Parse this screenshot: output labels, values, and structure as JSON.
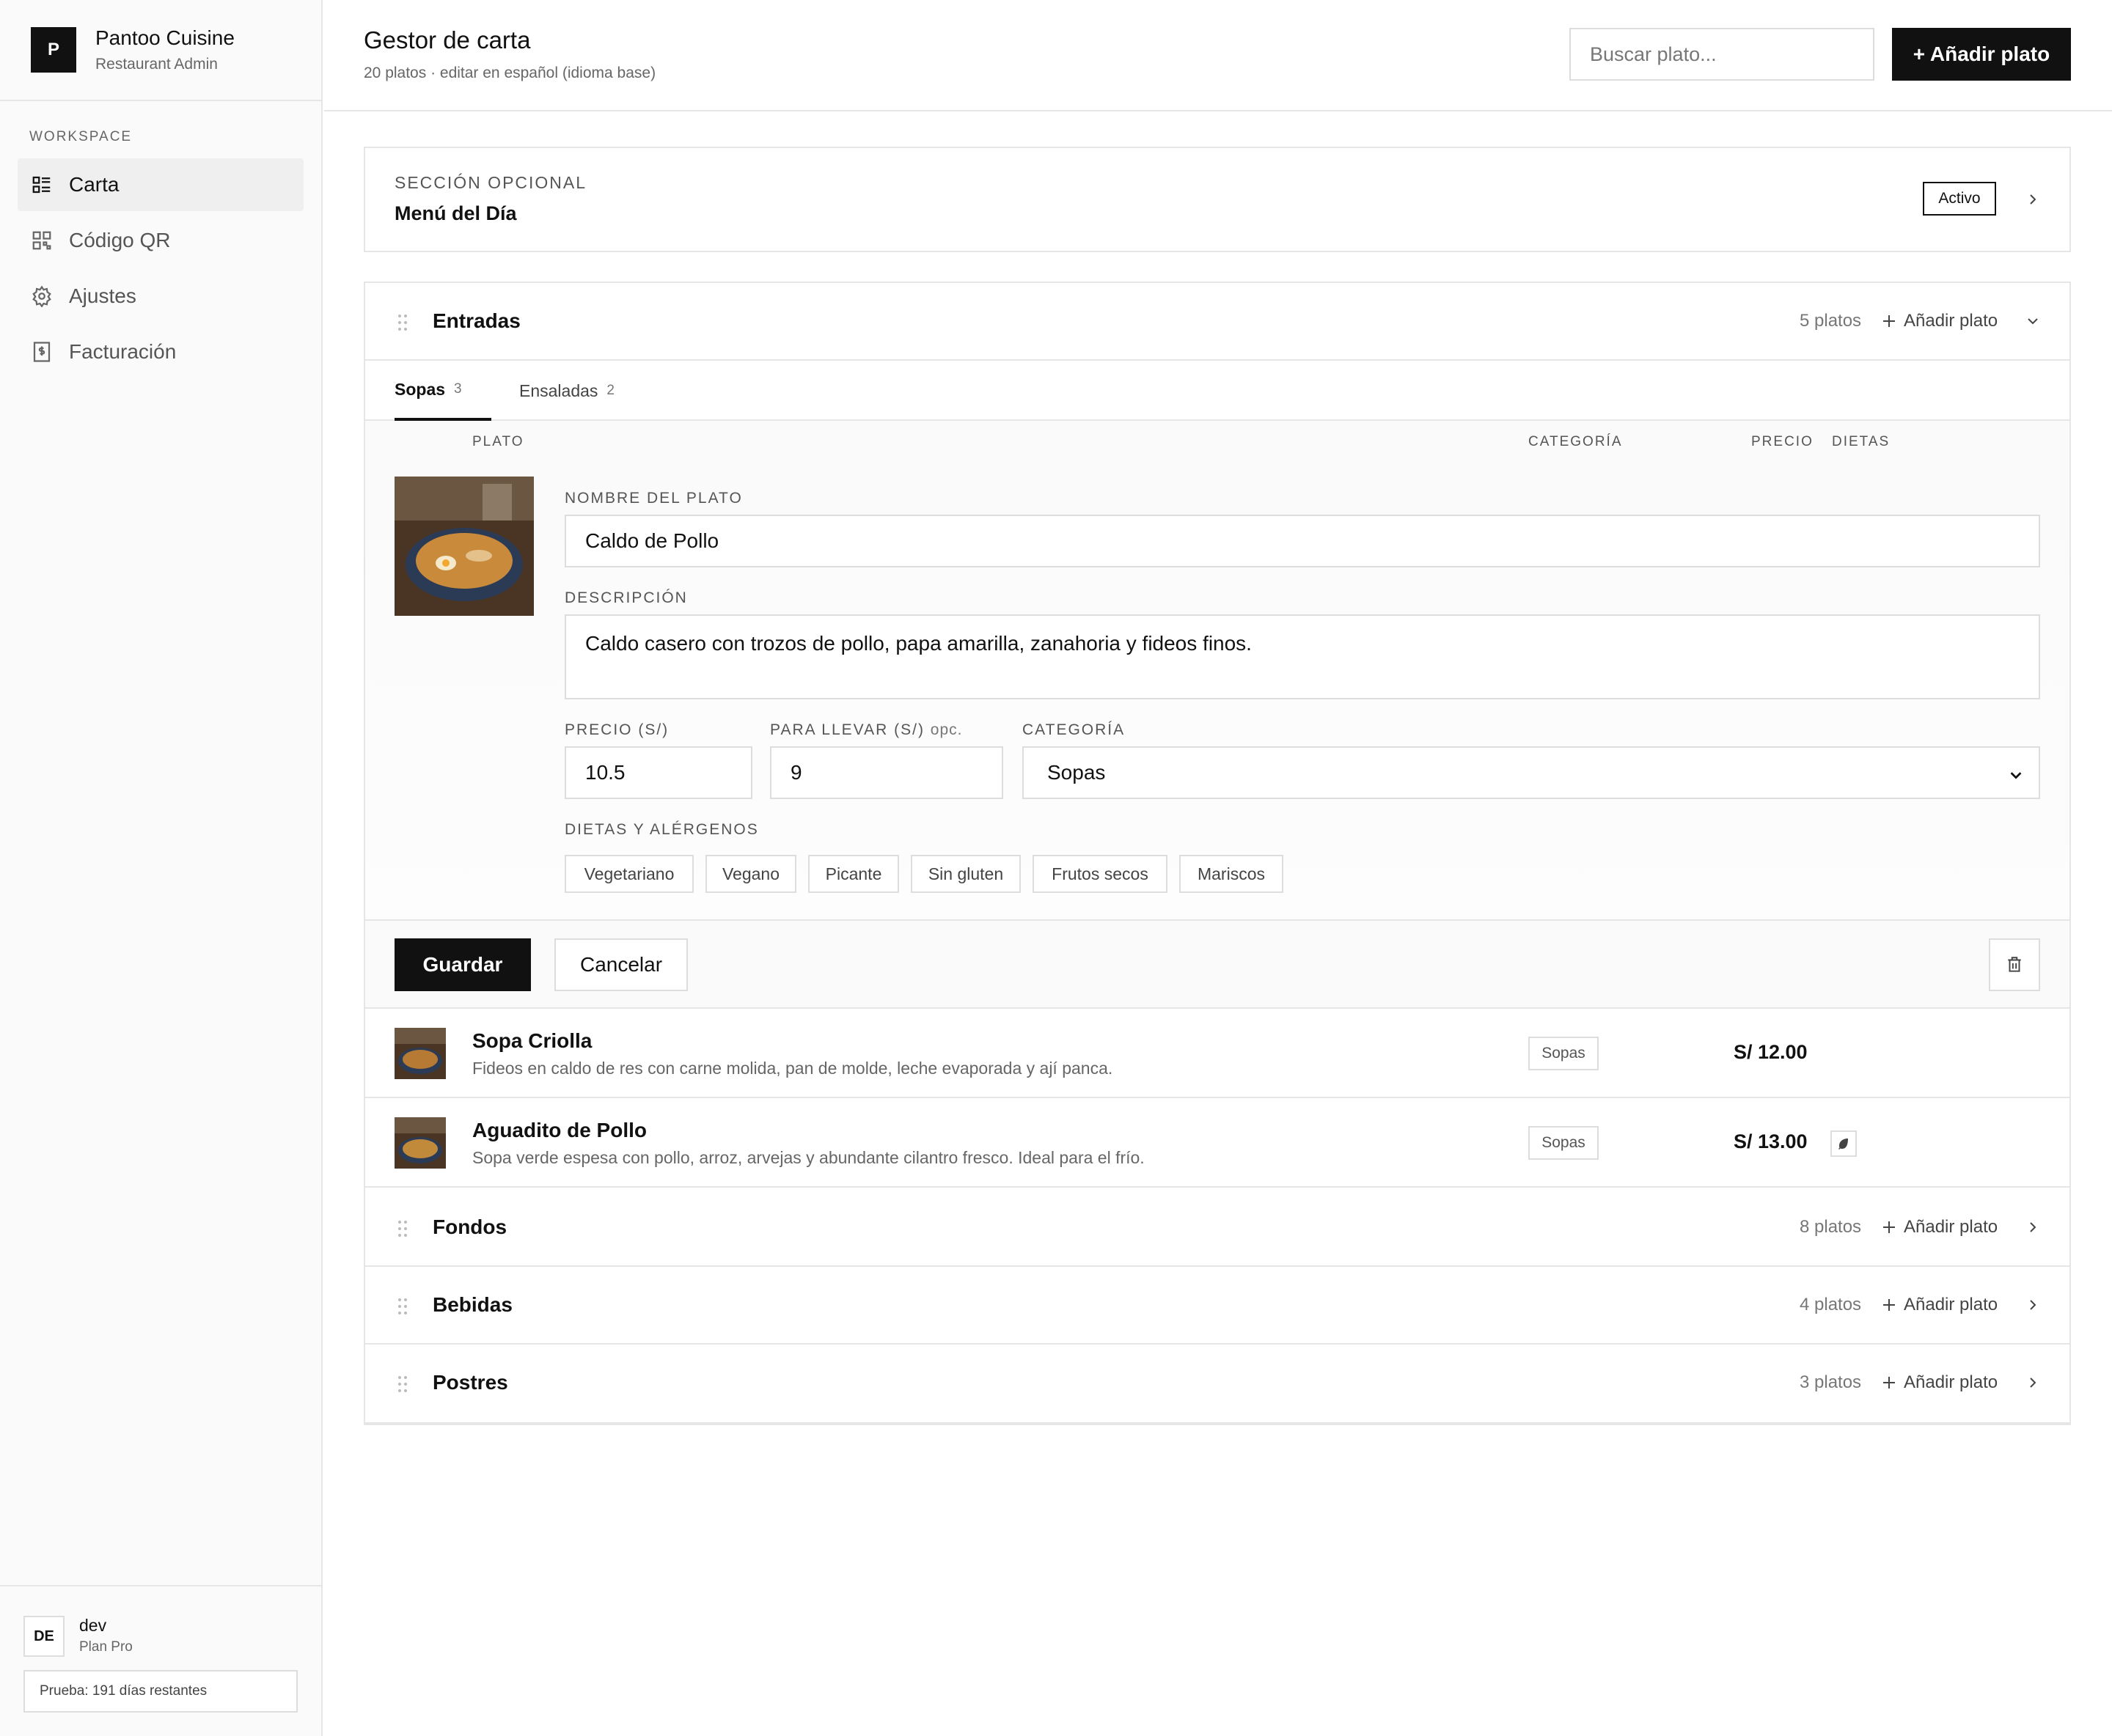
{
  "brand": {
    "logo_letter": "P",
    "name": "Pantoo Cuisine",
    "subtitle": "Restaurant Admin"
  },
  "sidebar": {
    "section_label": "WORKSPACE",
    "items": [
      {
        "label": "Carta",
        "icon": "menu-list-icon",
        "active": true
      },
      {
        "label": "Código QR",
        "icon": "qr-code-icon",
        "active": false
      },
      {
        "label": "Ajustes",
        "icon": "gear-icon",
        "active": false
      },
      {
        "label": "Facturación",
        "icon": "invoice-icon",
        "active": false
      }
    ],
    "user": {
      "initials": "DE",
      "name": "dev",
      "plan": "Plan Pro",
      "trial": "Prueba: 191 días restantes"
    }
  },
  "header": {
    "title": "Gestor de carta",
    "subtitle": "20 platos · editar en español (idioma base)",
    "search_placeholder": "Buscar plato...",
    "add_button": "+ Añadir plato"
  },
  "optional_section": {
    "label": "SECCIÓN OPCIONAL",
    "title": "Menú del Día",
    "status": "Activo"
  },
  "section": {
    "title": "Entradas",
    "count": "5 platos",
    "add_label": "Añadir plato",
    "tabs": [
      {
        "label": "Sopas",
        "count": "3",
        "active": true
      },
      {
        "label": "Ensaladas",
        "count": "2",
        "active": false
      }
    ],
    "columns": {
      "dish": "PLATO",
      "category": "CATEGORÍA",
      "price": "PRECIO",
      "diets": "DIETAS"
    }
  },
  "editor": {
    "name_label": "NOMBRE DEL PLATO",
    "name_value": "Caldo de Pollo",
    "desc_label": "DESCRIPCIÓN",
    "desc_value": "Caldo casero con trozos de pollo, papa amarilla, zanahoria y fideos finos.",
    "price_label": "PRECIO (S/)",
    "price_value": "10.5",
    "takeaway_label": "PARA LLEVAR (S/)",
    "takeaway_opt": "opc.",
    "takeaway_value": "9",
    "category_label": "CATEGORÍA",
    "category_value": "Sopas",
    "diets_label": "DIETAS Y ALÉRGENOS",
    "diets": [
      "Vegetariano",
      "Vegano",
      "Picante",
      "Sin gluten",
      "Frutos secos",
      "Mariscos"
    ],
    "save": "Guardar",
    "cancel": "Cancelar"
  },
  "rows": [
    {
      "name": "Sopa Criolla",
      "desc": "Fideos en caldo de res con carne molida, pan de molde, leche evaporada y ají panca.",
      "category": "Sopas",
      "price": "S/ 12.00",
      "diet_icon": ""
    },
    {
      "name": "Aguadito de Pollo",
      "desc": "Sopa verde espesa con pollo, arroz, arvejas y abundante cilantro fresco. Ideal para el frío.",
      "category": "Sopas",
      "price": "S/ 13.00",
      "diet_icon": "leaf-icon"
    }
  ],
  "other_sections": [
    {
      "title": "Fondos",
      "count": "8 platos",
      "add_label": "Añadir plato"
    },
    {
      "title": "Bebidas",
      "count": "4 platos",
      "add_label": "Añadir plato"
    },
    {
      "title": "Postres",
      "count": "3 platos",
      "add_label": "Añadir plato"
    }
  ]
}
